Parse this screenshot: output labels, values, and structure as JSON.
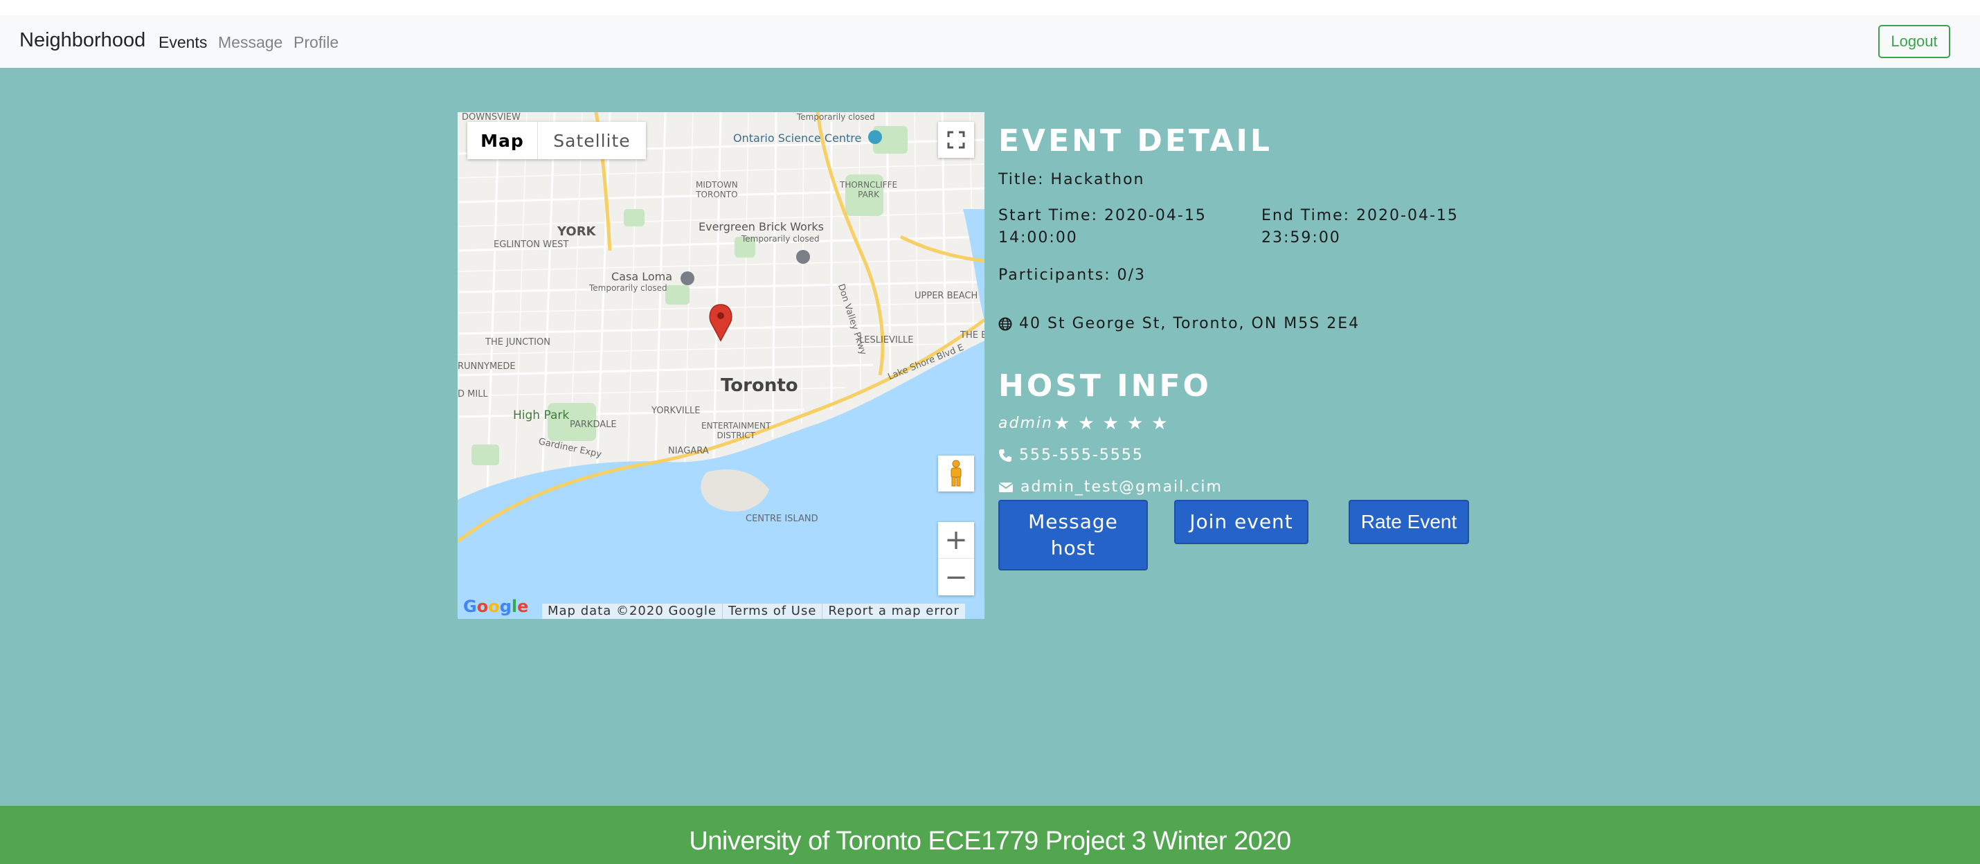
{
  "navbar": {
    "brand": "Neighborhood",
    "links": [
      {
        "label": "Events",
        "active": true
      },
      {
        "label": "Message",
        "active": false
      },
      {
        "label": "Profile",
        "active": false
      }
    ],
    "logout_label": "Logout"
  },
  "map": {
    "type_options": [
      "Map",
      "Satellite"
    ],
    "selected_type": "Map",
    "city_label": "Toronto",
    "labels": {
      "downsview": "DOWNSVIEW",
      "york": "YORK",
      "eglinton_west": "EGLINTON WEST",
      "the_junction": "THE JUNCTION",
      "runnymede": "RUNNYMEDE",
      "mill": "D MILL",
      "high_park": "High Park",
      "parkdale": "PARKDALE",
      "niagara": "NIAGARA",
      "entertainment_district": "ENTERTAINMENT\nDISTRICT",
      "yorkville": "YORKVILLE",
      "centre_island": "CENTRE ISLAND",
      "leslieville": "LESLIEVILLE",
      "upper_beach": "UPPER BEACH",
      "midtown_toronto": "MIDTOWN\nTORONTO",
      "thorncliffe_park": "THORNCLIFFE\nPARK",
      "ontario_science_centre": "Ontario Science Centre",
      "temporarily_closed": "Temporarily closed",
      "evergreen_brick_works": "Evergreen Brick Works",
      "casa_loma": "Casa Loma",
      "gardiner_expy": "Gardiner Expy",
      "lake_shore_blvd": "Lake Shore Blvd E",
      "don_valley_pkwy": "Don Valley Pkwy",
      "the_b": "THE B"
    },
    "google_logo": "Google",
    "footer": [
      "Map data ©2020 Google",
      "Terms of Use",
      "Report a map error"
    ],
    "colors": {
      "water": "#aadaff",
      "land": "#f1f0ec",
      "park": "#c8e6c2",
      "highway": "#f6cf65",
      "pin": "#d93a2b"
    }
  },
  "event": {
    "heading": "EVENT DETAIL",
    "title": "Title: Hackathon",
    "start_time_line1": "Start Time: 2020-04-15",
    "start_time_line2": "14:00:00",
    "end_time_line1": "End Time: 2020-04-15",
    "end_time_line2": "23:59:00",
    "participants": "Participants: 0/3",
    "address": "40 St George St, Toronto, ON M5S 2E4"
  },
  "host": {
    "heading": "HOST INFO",
    "name": "admin",
    "rating": 5,
    "rating_max": 5,
    "phone": "555-555-5555",
    "email": "admin_test@gmail.cim"
  },
  "actions": {
    "message_host_line1": "Message",
    "message_host_line2": "host",
    "join_event": "Join event",
    "rate_event": "Rate Event"
  },
  "footer": {
    "text": "University of Toronto ECE1779 Project 3 Winter 2020"
  },
  "theme": {
    "main_bg": "#83c0bd",
    "footer_bg": "#52a650",
    "button_bg": "#2563c9",
    "logout_color": "#3ba34b"
  }
}
